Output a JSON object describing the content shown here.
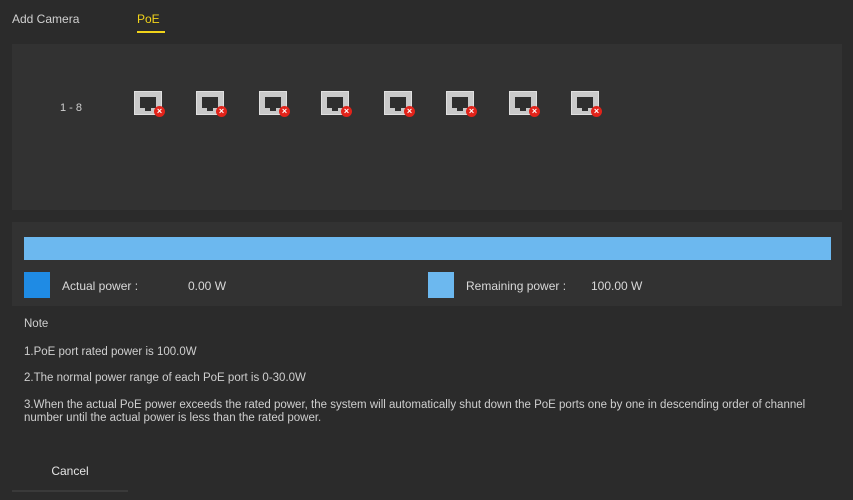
{
  "tabs": {
    "add_camera": "Add Camera",
    "poe": "PoE"
  },
  "ports": {
    "range_label": "1 - 8",
    "items": [
      {
        "icon": "ethernet-port-disconnected-icon",
        "badge": "×"
      },
      {
        "icon": "ethernet-port-disconnected-icon",
        "badge": "×"
      },
      {
        "icon": "ethernet-port-disconnected-icon",
        "badge": "×"
      },
      {
        "icon": "ethernet-port-disconnected-icon",
        "badge": "×"
      },
      {
        "icon": "ethernet-port-disconnected-icon",
        "badge": "×"
      },
      {
        "icon": "ethernet-port-disconnected-icon",
        "badge": "×"
      },
      {
        "icon": "ethernet-port-disconnected-icon",
        "badge": "×"
      },
      {
        "icon": "ethernet-port-disconnected-icon",
        "badge": "×"
      }
    ]
  },
  "power": {
    "actual_label": "Actual power :",
    "actual_value": "0.00 W",
    "remaining_label": "Remaining power :",
    "remaining_value": "100.00 W",
    "actual_fraction": 0.0,
    "colors": {
      "actual": "#1f8be4",
      "remaining": "#6cb8ef"
    }
  },
  "notes": {
    "heading": "Note",
    "line1": "1.PoE port rated power is 100.0W",
    "line2": "2.The normal power range of each PoE port is 0-30.0W",
    "line3": "3.When the actual PoE power exceeds the rated power, the system will automatically shut down the PoE ports one by one in descending order of channel number until the actual power is less than the rated power."
  },
  "buttons": {
    "cancel": "Cancel"
  },
  "colors": {
    "accent": "#f1d31a"
  }
}
